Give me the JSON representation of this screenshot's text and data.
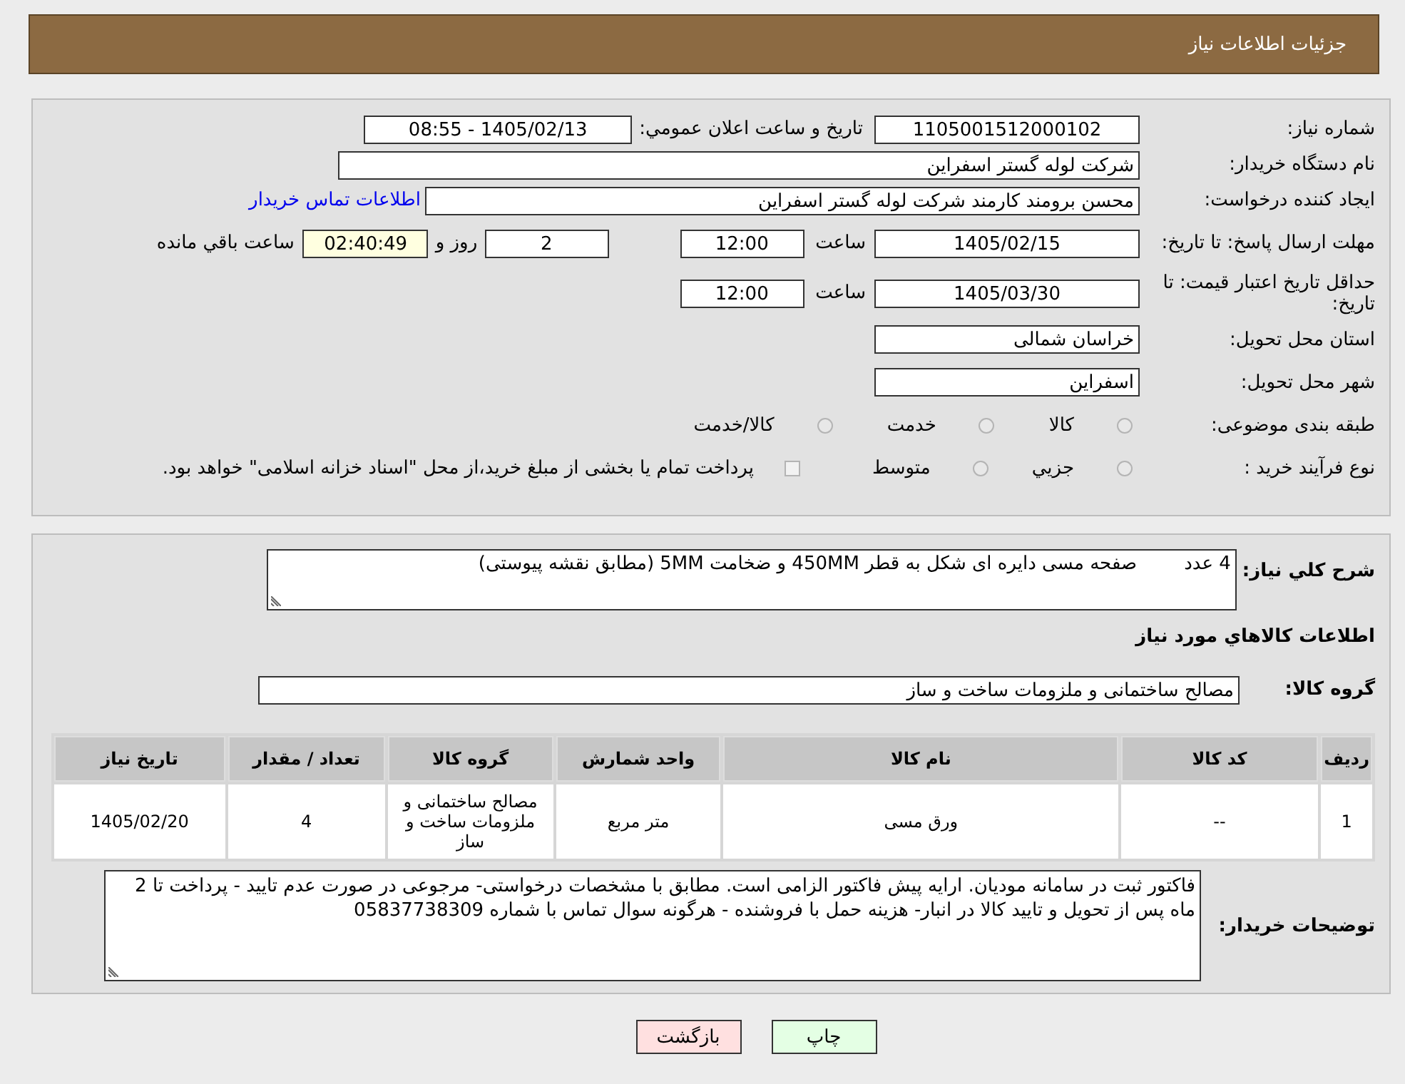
{
  "header": {
    "title": "جزئیات اطلاعات نیاز"
  },
  "need_number": {
    "label": "شماره نیاز:",
    "value": "1105001512000102"
  },
  "announce": {
    "label": "تاریخ و ساعت اعلان عمومي:",
    "value": "1405/02/13 - 08:55"
  },
  "buyer_org": {
    "label": "نام دستگاه خریدار:",
    "value": "شرکت لوله گستر اسفراین"
  },
  "creator": {
    "label": "ایجاد کننده درخواست:",
    "value": "محسن برومند کارمند شرکت لوله گستر اسفراین",
    "link": "اطلاعات تماس خریدار"
  },
  "reply_deadline": {
    "label": "مهلت ارسال پاسخ: تا تاریخ:",
    "date": "1405/02/15",
    "time_label": "ساعت",
    "time": "12:00",
    "days": "2",
    "days_label": "روز و",
    "remaining": "02:40:49",
    "remaining_label": "ساعت باقي مانده"
  },
  "price_validity": {
    "label": "حداقل تاریخ اعتبار قیمت: تا تاریخ:",
    "date": "1405/03/30",
    "time_label": "ساعت",
    "time": "12:00"
  },
  "province": {
    "label": "استان محل تحویل:",
    "value": "خراسان شمالی"
  },
  "city": {
    "label": "شهر محل تحویل:",
    "value": "اسفراین"
  },
  "category": {
    "label": "طبقه بندی موضوعی:",
    "options": [
      {
        "label": "کالا",
        "selected": false
      },
      {
        "label": "خدمت",
        "selected": false
      },
      {
        "label": "کالا/خدمت",
        "selected": false
      }
    ]
  },
  "purchase_type": {
    "label": "نوع فرآیند خرید :",
    "options": [
      {
        "label": "جزيي",
        "selected": false
      },
      {
        "label": "متوسط",
        "selected": false
      }
    ],
    "payment_note": {
      "text": "پرداخت تمام یا بخشی از مبلغ خرید،از محل \"اسناد خزانه اسلامی\" خواهد بود.",
      "checked": false
    }
  },
  "summary": {
    "label": "شرح كلي نياز:",
    "value": "4 عدد        صفحه مسی دایره ای شکل به قطر 450MM و ضخامت 5MM (مطابق نقشه پیوستی)"
  },
  "goods_heading": "اطلاعات كالاهاي مورد نياز",
  "goods_group": {
    "label": "گروه کالا:",
    "value": "مصالح ساختمانی و ملزومات ساخت و ساز"
  },
  "table": {
    "columns": [
      "ردیف",
      "کد کالا",
      "نام کالا",
      "واحد شمارش",
      "گروه کالا",
      "تعداد / مقدار",
      "تاریخ نیاز"
    ],
    "rows": [
      [
        "1",
        "--",
        "ورق مسی",
        "متر مربع",
        "مصالح ساختمانی و ملزومات ساخت و ساز",
        "4",
        "1405/02/20"
      ]
    ]
  },
  "buyer_notes": {
    "label": "توضیحات خریدار:",
    "value": "فاکتور ثبت در سامانه مودیان. ارایه پیش فاکتور الزامی است. مطابق با مشخصات درخواستی- مرجوعی در صورت عدم تایید - پرداخت تا 2 ماه پس از تحویل و تایید کالا در انبار- هزینه حمل با فروشنده - هرگونه سوال تماس با شماره 05837738309"
  },
  "buttons": [
    {
      "label": "چاپ",
      "kind": "print"
    },
    {
      "label": "بازگشت",
      "kind": "back"
    }
  ]
}
